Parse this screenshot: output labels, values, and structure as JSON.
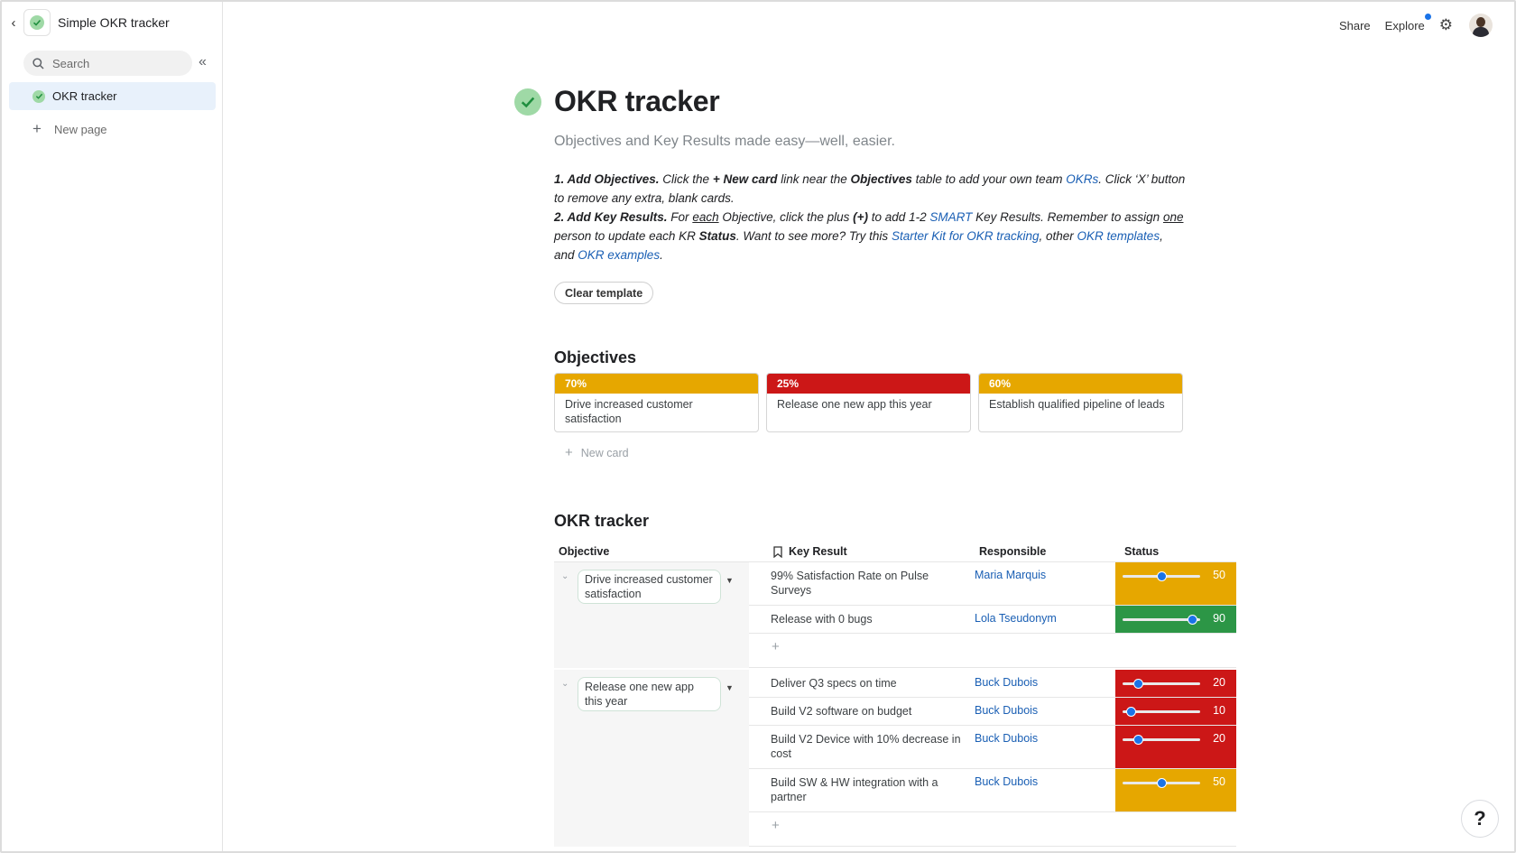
{
  "colors": {
    "yellow": "#e6a700",
    "red": "#cc1717",
    "green": "#2c9646",
    "link": "#1a5fb4",
    "check": "#9fd9a6"
  },
  "sidebar": {
    "doc_title": "Simple OKR tracker",
    "search_label": "Search",
    "active_page": "OKR tracker",
    "new_page": "New page"
  },
  "topbar": {
    "share": "Share",
    "explore": "Explore"
  },
  "main": {
    "title": "OKR tracker",
    "subtitle": "Objectives and Key Results made easy—well, easier.",
    "instructions": {
      "s1_bold": "1. Add Objectives.",
      "s1_a": " Click the ",
      "s1_newcard": "+ New card",
      "s1_b": " link near the ",
      "s1_objectives": "Objectives",
      "s1_c": " table to add your own team ",
      "s1_okrs": "OKRs",
      "s1_d": ". Click ‘X’ button to remove any extra, blank cards.",
      "s2_bold": "2. Add Key Results.",
      "s2_a": " For ",
      "s2_each": "each",
      "s2_b": " Objective, click the plus ",
      "s2_plus": "(+)",
      "s2_c": " to add 1-2 ",
      "s2_smart": "SMART",
      "s2_d": " Key Results. Remember to assign ",
      "s2_one": "one",
      "s2_e": " person to update each KR ",
      "s2_status": "Status",
      "s2_f": ". Want to see more? Try this ",
      "s2_starter": "Starter Kit for OKR tracking",
      "s2_g": ", other ",
      "s2_templates": "OKR templates",
      "s2_h": ", and ",
      "s2_examples": "OKR examples",
      "s2_i": "."
    },
    "clear_button": "Clear template",
    "objectives_heading": "Objectives",
    "cards": [
      {
        "percent": "70%",
        "label": "Drive increased customer satisfaction",
        "color": "#e6a700"
      },
      {
        "percent": "25%",
        "label": "Release one new app this year",
        "color": "#cc1717"
      },
      {
        "percent": "60%",
        "label": "Establish qualified pipeline of leads",
        "color": "#e6a700"
      }
    ],
    "new_card": "New card",
    "tracker_heading": "OKR tracker",
    "table": {
      "headers": {
        "objective": "Objective",
        "key_result": "Key Result",
        "responsible": "Responsible",
        "status": "Status"
      },
      "groups": [
        {
          "objective": "Drive increased customer satisfaction",
          "rows": [
            {
              "kr": "99% Satisfaction Rate on Pulse Surveys",
              "responsible": "Maria Marquis",
              "status": "50",
              "level": 50,
              "color": "#e6a700"
            },
            {
              "kr": "Release with 0 bugs",
              "responsible": "Lola Tseudonym",
              "status": "90",
              "level": 90,
              "color": "#2c9646"
            }
          ]
        },
        {
          "objective": "Release one new app this year",
          "rows": [
            {
              "kr": "Deliver Q3 specs on time",
              "responsible": "Buck Dubois",
              "status": "20",
              "level": 20,
              "color": "#cc1717"
            },
            {
              "kr": "Build V2 software on budget",
              "responsible": "Buck Dubois",
              "status": "10",
              "level": 10,
              "color": "#cc1717"
            },
            {
              "kr": "Build V2 Device with 10% decrease in cost",
              "responsible": "Buck Dubois",
              "status": "20",
              "level": 20,
              "color": "#cc1717"
            },
            {
              "kr": "Build SW & HW integration with a partner",
              "responsible": "Buck Dubois",
              "status": "50",
              "level": 50,
              "color": "#e6a700"
            }
          ]
        }
      ]
    }
  },
  "help_label": "?"
}
